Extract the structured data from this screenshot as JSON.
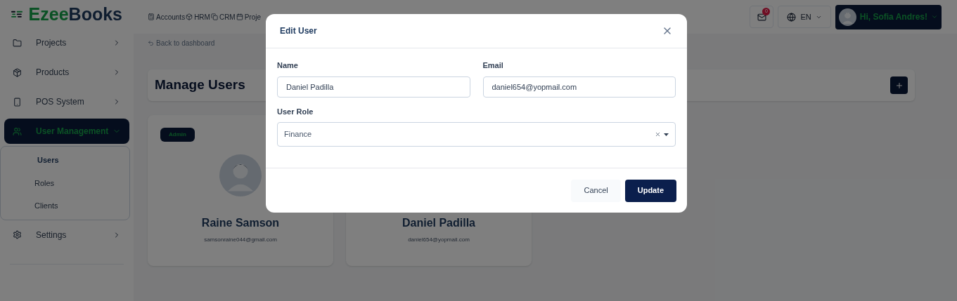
{
  "brand": {
    "part_1": "Ezee",
    "part_2": "Books"
  },
  "top_nav": [
    {
      "label": "Accounts"
    },
    {
      "label": "HRM"
    },
    {
      "label": "CRM"
    },
    {
      "label": "Proje"
    }
  ],
  "header": {
    "notification_count": "0",
    "language": "EN",
    "greeting": "Hi, Sofia Andres!"
  },
  "sidebar": {
    "items": [
      {
        "label": "Projects",
        "expanded": false,
        "selected": false
      },
      {
        "label": "Products",
        "expanded": false,
        "selected": false
      },
      {
        "label": "POS System",
        "expanded": false,
        "selected": false
      },
      {
        "label": "User Management",
        "expanded": true,
        "selected": true,
        "children": [
          {
            "label": "Users",
            "selected": true
          },
          {
            "label": "Roles",
            "selected": false
          },
          {
            "label": "Clients",
            "selected": false
          }
        ]
      },
      {
        "label": "Settings",
        "expanded": false,
        "selected": false
      }
    ]
  },
  "back_link": "Back to dashboard",
  "page_title": "Manage Users",
  "users": [
    {
      "badge": "Admin",
      "avatar": true,
      "name": "Raine Samson",
      "email": "samsonraine044@gmail.com"
    },
    {
      "name": "Daniel Padilla",
      "email": "daniel654@yopmail.com"
    }
  ],
  "dialog": {
    "title": "Edit User",
    "fields": [
      {
        "label": "Name",
        "value": "Daniel Padilla"
      },
      {
        "label": "Email",
        "value": "daniel654@yopmail.com"
      }
    ],
    "role": {
      "label": "User Role",
      "value": "Finance"
    },
    "buttons": [
      {
        "label": "Cancel",
        "kind": "secondary"
      },
      {
        "label": "Update",
        "kind": "primary"
      }
    ]
  }
}
